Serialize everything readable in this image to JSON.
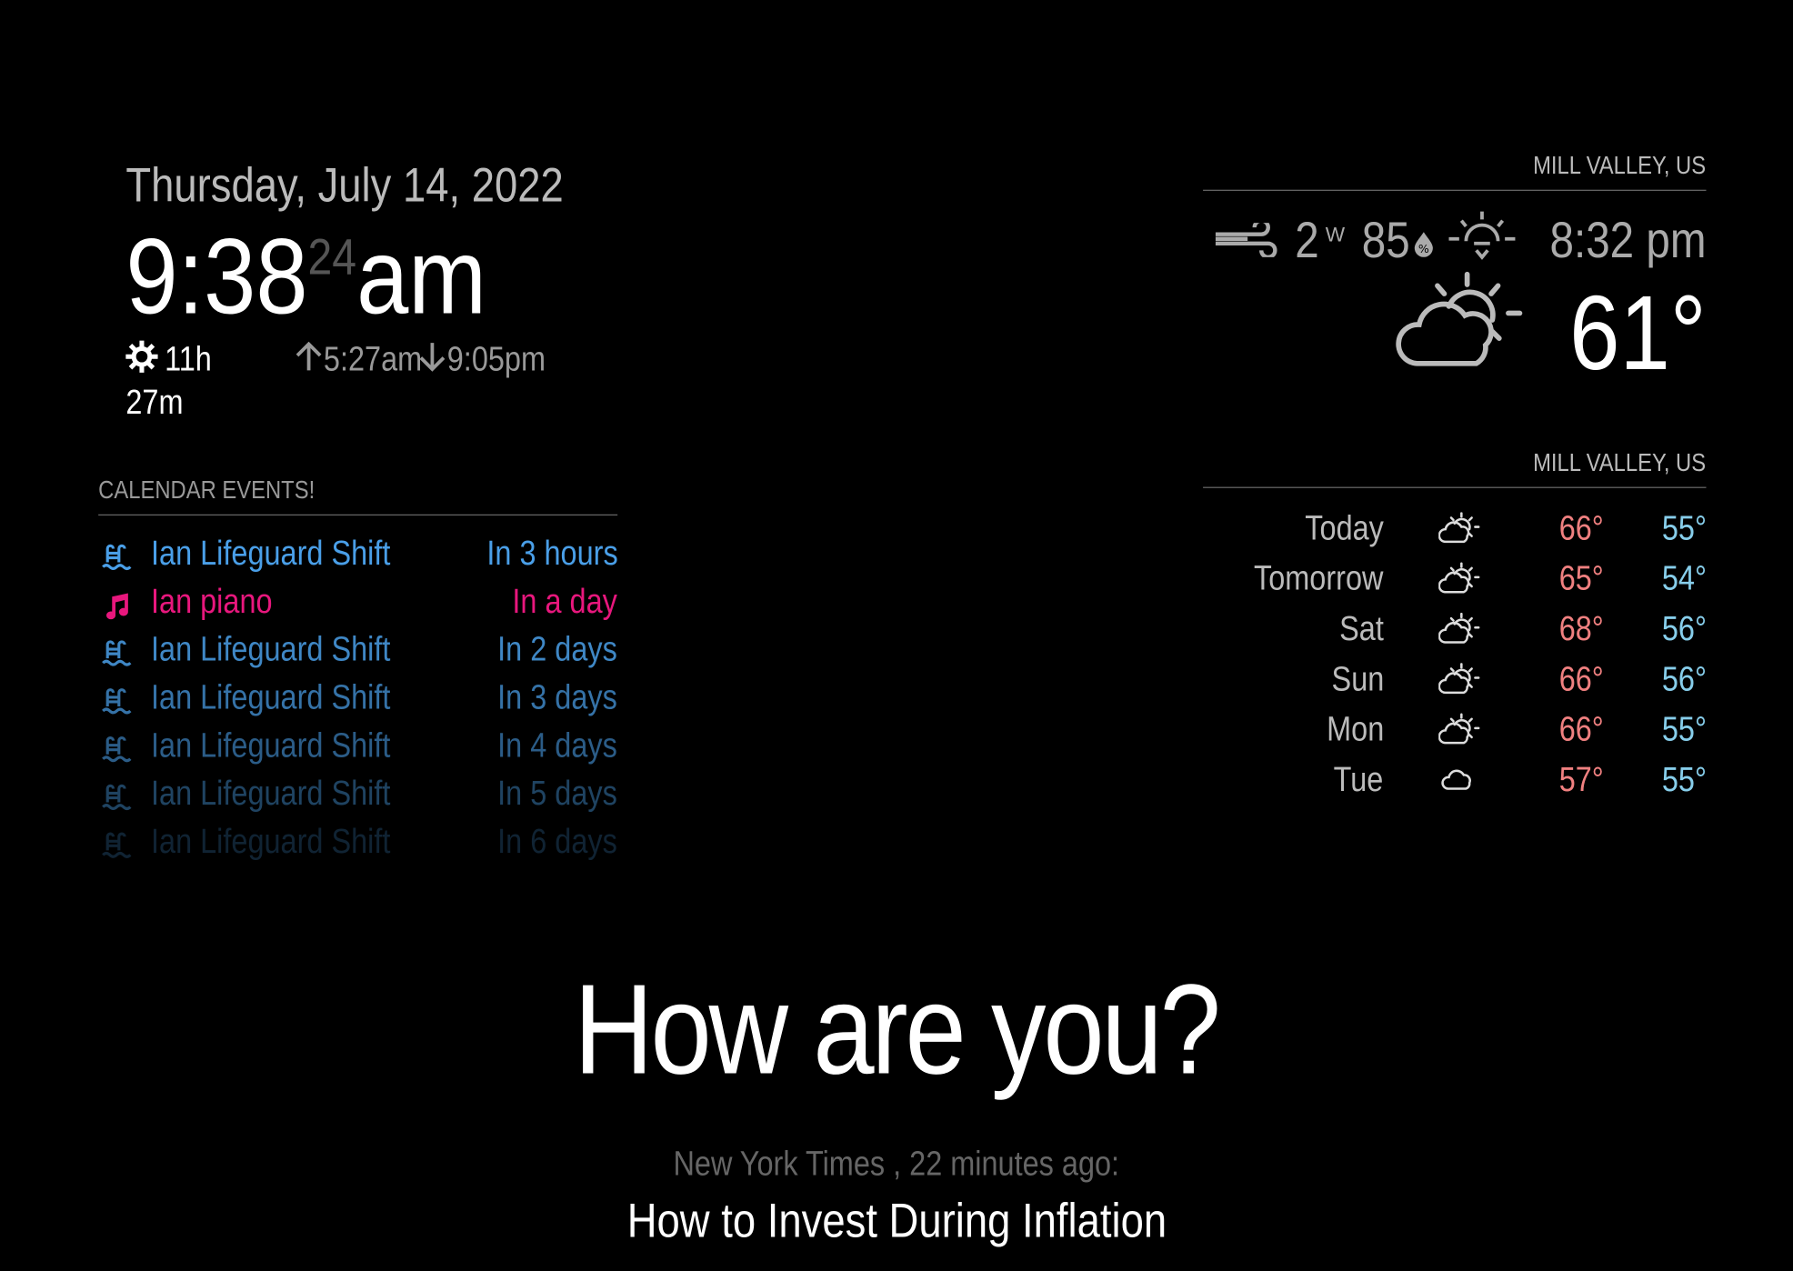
{
  "clock": {
    "date": "Thursday, July 14, 2022",
    "hours_minutes": "9:38",
    "seconds": "24",
    "ampm": "am",
    "day_length_hours": "11h",
    "day_length_minutes": "27m",
    "sunrise": "5:27am",
    "sunset": "9:05pm"
  },
  "calendar": {
    "header": "CALENDAR EVENTS!",
    "events": [
      {
        "title": "Ian Lifeguard Shift",
        "when": "In 3 hours",
        "icon": "swimmer-icon",
        "color": "#4a9fe8",
        "opacity": 1.0
      },
      {
        "title": "Ian piano",
        "when": "In a day",
        "icon": "music-note-icon",
        "color": "#e8177d",
        "opacity": 1.0
      },
      {
        "title": "Ian Lifeguard Shift",
        "when": "In 2 days",
        "icon": "swimmer-icon",
        "color": "#4a9fe8",
        "opacity": 0.85
      },
      {
        "title": "Ian Lifeguard Shift",
        "when": "In 3 days",
        "icon": "swimmer-icon",
        "color": "#4a9fe8",
        "opacity": 0.72
      },
      {
        "title": "Ian Lifeguard Shift",
        "when": "In 4 days",
        "icon": "swimmer-icon",
        "color": "#4a9fe8",
        "opacity": 0.58
      },
      {
        "title": "Ian Lifeguard Shift",
        "when": "In 5 days",
        "icon": "swimmer-icon",
        "color": "#4a9fe8",
        "opacity": 0.42
      },
      {
        "title": "Ian Lifeguard Shift",
        "when": "In 6 days",
        "icon": "swimmer-icon",
        "color": "#4a9fe8",
        "opacity": 0.22
      }
    ]
  },
  "current_weather": {
    "location": "MILL VALLEY, US",
    "wind_speed": "2",
    "wind_direction": "W",
    "humidity": "85",
    "sunset_time": "8:32 pm",
    "temperature": "61°",
    "condition_icon": "partly-cloudy-day-icon"
  },
  "forecast": {
    "location": "MILL VALLEY, US",
    "days": [
      {
        "day": "Today",
        "high": "66°",
        "low": "55°",
        "icon": "partly-cloudy-icon"
      },
      {
        "day": "Tomorrow",
        "high": "65°",
        "low": "54°",
        "icon": "partly-cloudy-icon"
      },
      {
        "day": "Sat",
        "high": "68°",
        "low": "56°",
        "icon": "partly-cloudy-icon"
      },
      {
        "day": "Sun",
        "high": "66°",
        "low": "56°",
        "icon": "partly-cloudy-icon"
      },
      {
        "day": "Mon",
        "high": "66°",
        "low": "55°",
        "icon": "partly-cloudy-icon"
      },
      {
        "day": "Tue",
        "high": "57°",
        "low": "55°",
        "icon": "cloudy-icon"
      }
    ]
  },
  "compliment": "How are you?",
  "news": {
    "source": "New York Times , 22 minutes ago:",
    "headline": "How to Invest During Inflation"
  },
  "colors": {
    "background": "#000000",
    "calendar_blue": "#4a9fe8",
    "calendar_pink": "#e8177d",
    "forecast_high": "#f08080",
    "forecast_low": "#87ceeb"
  }
}
